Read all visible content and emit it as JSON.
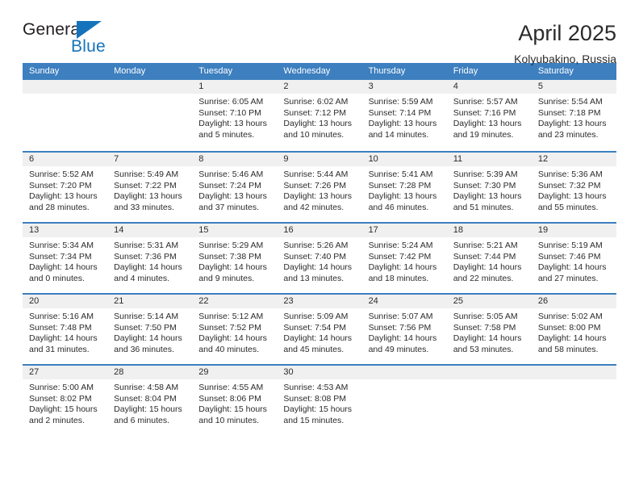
{
  "brand": {
    "name_part1": "General",
    "name_part2": "Blue",
    "logo_icon": "triangle-icon",
    "accent_color": "#1573bb"
  },
  "header": {
    "title": "April 2025",
    "subtitle": "Kolyubakino, Russia"
  },
  "theme": {
    "header_blue": "#3d7fbf",
    "daynum_band": "#f0f0f0",
    "text": "#2b2b2b"
  },
  "calendar": {
    "weekday_headers": [
      "Sunday",
      "Monday",
      "Tuesday",
      "Wednesday",
      "Thursday",
      "Friday",
      "Saturday"
    ],
    "weeks": [
      [
        {
          "day": "",
          "empty": true,
          "lines": []
        },
        {
          "day": "",
          "empty": true,
          "lines": []
        },
        {
          "day": "1",
          "empty": false,
          "lines": [
            "Sunrise: 6:05 AM",
            "Sunset: 7:10 PM",
            "Daylight: 13 hours",
            "and 5 minutes."
          ]
        },
        {
          "day": "2",
          "empty": false,
          "lines": [
            "Sunrise: 6:02 AM",
            "Sunset: 7:12 PM",
            "Daylight: 13 hours",
            "and 10 minutes."
          ]
        },
        {
          "day": "3",
          "empty": false,
          "lines": [
            "Sunrise: 5:59 AM",
            "Sunset: 7:14 PM",
            "Daylight: 13 hours",
            "and 14 minutes."
          ]
        },
        {
          "day": "4",
          "empty": false,
          "lines": [
            "Sunrise: 5:57 AM",
            "Sunset: 7:16 PM",
            "Daylight: 13 hours",
            "and 19 minutes."
          ]
        },
        {
          "day": "5",
          "empty": false,
          "lines": [
            "Sunrise: 5:54 AM",
            "Sunset: 7:18 PM",
            "Daylight: 13 hours",
            "and 23 minutes."
          ]
        }
      ],
      [
        {
          "day": "6",
          "empty": false,
          "lines": [
            "Sunrise: 5:52 AM",
            "Sunset: 7:20 PM",
            "Daylight: 13 hours",
            "and 28 minutes."
          ]
        },
        {
          "day": "7",
          "empty": false,
          "lines": [
            "Sunrise: 5:49 AM",
            "Sunset: 7:22 PM",
            "Daylight: 13 hours",
            "and 33 minutes."
          ]
        },
        {
          "day": "8",
          "empty": false,
          "lines": [
            "Sunrise: 5:46 AM",
            "Sunset: 7:24 PM",
            "Daylight: 13 hours",
            "and 37 minutes."
          ]
        },
        {
          "day": "9",
          "empty": false,
          "lines": [
            "Sunrise: 5:44 AM",
            "Sunset: 7:26 PM",
            "Daylight: 13 hours",
            "and 42 minutes."
          ]
        },
        {
          "day": "10",
          "empty": false,
          "lines": [
            "Sunrise: 5:41 AM",
            "Sunset: 7:28 PM",
            "Daylight: 13 hours",
            "and 46 minutes."
          ]
        },
        {
          "day": "11",
          "empty": false,
          "lines": [
            "Sunrise: 5:39 AM",
            "Sunset: 7:30 PM",
            "Daylight: 13 hours",
            "and 51 minutes."
          ]
        },
        {
          "day": "12",
          "empty": false,
          "lines": [
            "Sunrise: 5:36 AM",
            "Sunset: 7:32 PM",
            "Daylight: 13 hours",
            "and 55 minutes."
          ]
        }
      ],
      [
        {
          "day": "13",
          "empty": false,
          "lines": [
            "Sunrise: 5:34 AM",
            "Sunset: 7:34 PM",
            "Daylight: 14 hours",
            "and 0 minutes."
          ]
        },
        {
          "day": "14",
          "empty": false,
          "lines": [
            "Sunrise: 5:31 AM",
            "Sunset: 7:36 PM",
            "Daylight: 14 hours",
            "and 4 minutes."
          ]
        },
        {
          "day": "15",
          "empty": false,
          "lines": [
            "Sunrise: 5:29 AM",
            "Sunset: 7:38 PM",
            "Daylight: 14 hours",
            "and 9 minutes."
          ]
        },
        {
          "day": "16",
          "empty": false,
          "lines": [
            "Sunrise: 5:26 AM",
            "Sunset: 7:40 PM",
            "Daylight: 14 hours",
            "and 13 minutes."
          ]
        },
        {
          "day": "17",
          "empty": false,
          "lines": [
            "Sunrise: 5:24 AM",
            "Sunset: 7:42 PM",
            "Daylight: 14 hours",
            "and 18 minutes."
          ]
        },
        {
          "day": "18",
          "empty": false,
          "lines": [
            "Sunrise: 5:21 AM",
            "Sunset: 7:44 PM",
            "Daylight: 14 hours",
            "and 22 minutes."
          ]
        },
        {
          "day": "19",
          "empty": false,
          "lines": [
            "Sunrise: 5:19 AM",
            "Sunset: 7:46 PM",
            "Daylight: 14 hours",
            "and 27 minutes."
          ]
        }
      ],
      [
        {
          "day": "20",
          "empty": false,
          "lines": [
            "Sunrise: 5:16 AM",
            "Sunset: 7:48 PM",
            "Daylight: 14 hours",
            "and 31 minutes."
          ]
        },
        {
          "day": "21",
          "empty": false,
          "lines": [
            "Sunrise: 5:14 AM",
            "Sunset: 7:50 PM",
            "Daylight: 14 hours",
            "and 36 minutes."
          ]
        },
        {
          "day": "22",
          "empty": false,
          "lines": [
            "Sunrise: 5:12 AM",
            "Sunset: 7:52 PM",
            "Daylight: 14 hours",
            "and 40 minutes."
          ]
        },
        {
          "day": "23",
          "empty": false,
          "lines": [
            "Sunrise: 5:09 AM",
            "Sunset: 7:54 PM",
            "Daylight: 14 hours",
            "and 45 minutes."
          ]
        },
        {
          "day": "24",
          "empty": false,
          "lines": [
            "Sunrise: 5:07 AM",
            "Sunset: 7:56 PM",
            "Daylight: 14 hours",
            "and 49 minutes."
          ]
        },
        {
          "day": "25",
          "empty": false,
          "lines": [
            "Sunrise: 5:05 AM",
            "Sunset: 7:58 PM",
            "Daylight: 14 hours",
            "and 53 minutes."
          ]
        },
        {
          "day": "26",
          "empty": false,
          "lines": [
            "Sunrise: 5:02 AM",
            "Sunset: 8:00 PM",
            "Daylight: 14 hours",
            "and 58 minutes."
          ]
        }
      ],
      [
        {
          "day": "27",
          "empty": false,
          "lines": [
            "Sunrise: 5:00 AM",
            "Sunset: 8:02 PM",
            "Daylight: 15 hours",
            "and 2 minutes."
          ]
        },
        {
          "day": "28",
          "empty": false,
          "lines": [
            "Sunrise: 4:58 AM",
            "Sunset: 8:04 PM",
            "Daylight: 15 hours",
            "and 6 minutes."
          ]
        },
        {
          "day": "29",
          "empty": false,
          "lines": [
            "Sunrise: 4:55 AM",
            "Sunset: 8:06 PM",
            "Daylight: 15 hours",
            "and 10 minutes."
          ]
        },
        {
          "day": "30",
          "empty": false,
          "lines": [
            "Sunrise: 4:53 AM",
            "Sunset: 8:08 PM",
            "Daylight: 15 hours",
            "and 15 minutes."
          ]
        },
        {
          "day": "",
          "empty": true,
          "lines": []
        },
        {
          "day": "",
          "empty": true,
          "lines": []
        },
        {
          "day": "",
          "empty": true,
          "lines": []
        }
      ]
    ]
  }
}
